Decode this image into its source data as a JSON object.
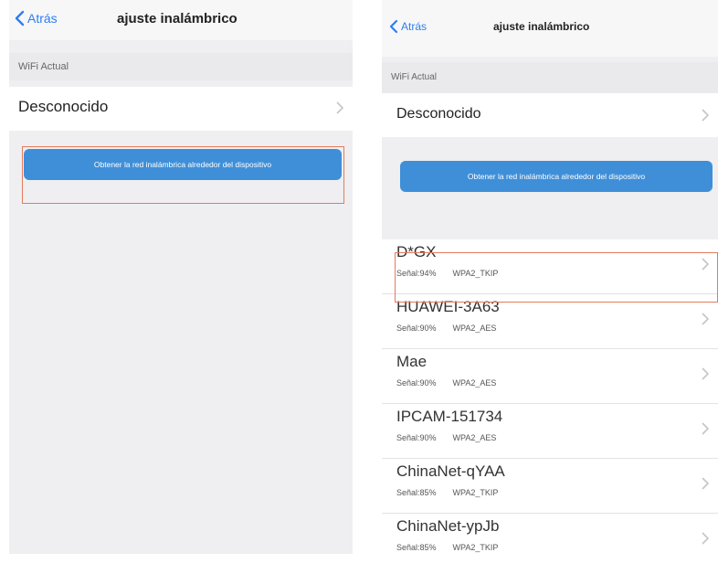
{
  "left": {
    "back_label": "Atrás",
    "title": "ajuste inalámbrico",
    "current_wifi_label": "WiFi Actual",
    "current_wifi_value": "Desconocido",
    "scan_button_label": "Obtener la red inalámbrica alrededor del dispositivo"
  },
  "right": {
    "back_label": "Atrás",
    "title": "ajuste inalámbrico",
    "current_wifi_label": "WiFi Actual",
    "current_wifi_value": "Desconocido",
    "scan_button_label": "Obtener la red inalámbrica alrededor del dispositivo",
    "networks": [
      {
        "ssid": "D*GX",
        "signal": "Señal:94%",
        "security": "WPA2_TKIP"
      },
      {
        "ssid": "HUAWEI-3A63",
        "signal": "Señal:90%",
        "security": "WPA2_AES"
      },
      {
        "ssid": "Mae",
        "signal": "Señal:90%",
        "security": "WPA2_AES"
      },
      {
        "ssid": "IPCAM-151734",
        "signal": "Señal:90%",
        "security": "WPA2_AES"
      },
      {
        "ssid": "ChinaNet-qYAA",
        "signal": "Señal:85%",
        "security": "WPA2_TKIP"
      },
      {
        "ssid": "ChinaNet-ypJb",
        "signal": "Señal:85%",
        "security": "WPA2_TKIP"
      }
    ]
  },
  "colors": {
    "accent": "#2d7ef0",
    "button": "#3f8fd8",
    "highlight": "#e37b5c"
  }
}
